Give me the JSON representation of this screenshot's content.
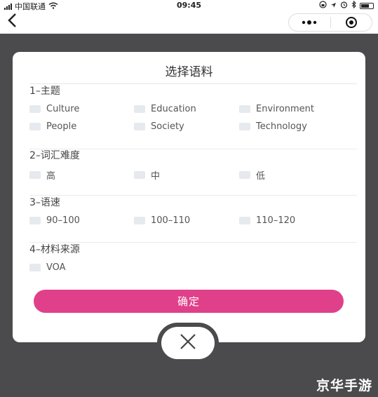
{
  "status_bar": {
    "carrier": "中国联通",
    "time": "09:45"
  },
  "modal": {
    "title": "选择语料",
    "sections": [
      {
        "title": "1–主题",
        "options": [
          "Culture",
          "Education",
          "Environment",
          "People",
          "Society",
          "Technology"
        ]
      },
      {
        "title": "2–词汇难度",
        "options": [
          "高",
          "中",
          "低"
        ]
      },
      {
        "title": "3–语速",
        "options": [
          "90–100",
          "100–110",
          "110–120"
        ]
      },
      {
        "title": "4–材料来源",
        "options": [
          "VOA"
        ]
      }
    ],
    "confirm_label": "确定"
  },
  "watermark": "京华手游",
  "colors": {
    "accent": "#e0408a",
    "overlay": "#4b4b4d",
    "checkbox": "#e6e9ee"
  }
}
